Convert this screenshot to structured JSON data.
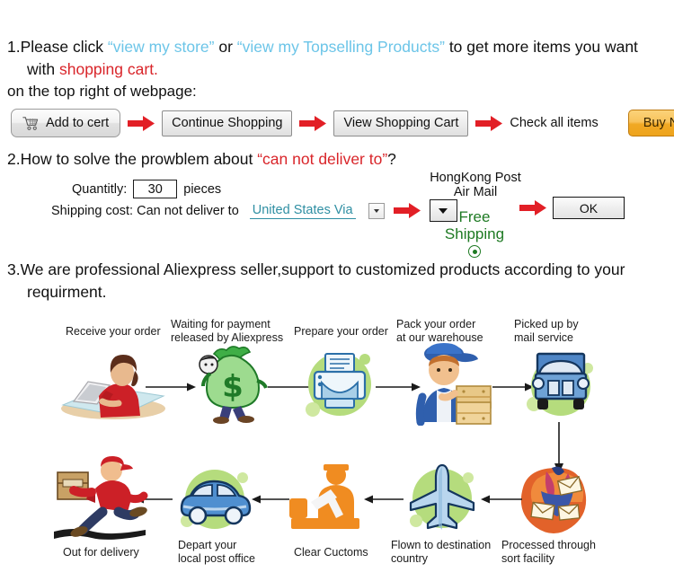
{
  "sections": {
    "one": {
      "number": "1.",
      "text_a": "Please click ",
      "link1": "“view my store”",
      "text_b": " or ",
      "link2": "“view my Topselling Products”",
      "text_c": " to get more items you want",
      "line2_a": "with ",
      "line2_highlight": "shopping cart.",
      "subtitle": "on the top right of webpage:"
    },
    "two": {
      "number": "2.",
      "text_a": "How to solve the prowblem about ",
      "highlight": "“can not deliver to”",
      "text_b": "?"
    },
    "three": {
      "number": "3.",
      "line1": "We are professional Aliexpress seller,support to customized products according to your",
      "line2": "requirment."
    }
  },
  "button_row": {
    "add_to_cart": "Add to cert",
    "continue_shopping": "Continue Shopping",
    "view_shopping_cart": "View Shopping Cart",
    "check_all_items": "Check all items",
    "buy_now": "Buy Now"
  },
  "form": {
    "quantity_label": "Quantitly:",
    "quantity_value": "30",
    "quantity_unit": "pieces",
    "shipping_label": "Shipping cost: Can not deliver to",
    "country_value": "United States Via",
    "carrier_line1": "HongKong Post",
    "carrier_line2": "Air Mail",
    "free_shipping_line1": "Free",
    "free_shipping_line2": "Shipping",
    "ok_button": "OK"
  },
  "flow": {
    "steps_top": [
      "Receive your order",
      "Waiting for payment\nreleased by Aliexpress",
      "Prepare your order",
      "Pack your order\nat our warehouse",
      "Picked up by\nmail service"
    ],
    "steps_bottom": [
      "Out for delivery",
      "Depart your\nlocal post office",
      "Clear Cuctoms",
      "Flown to destination\ncountry",
      "Processed through\nsort facility"
    ]
  },
  "colors": {
    "link_blue": "#6cc5e8",
    "red": "#d9252a",
    "teal": "#2f8fa3",
    "green": "#1e7a23",
    "buy_now_orange": "#f0a824",
    "icon_green_blob": "#b5dc7d"
  }
}
